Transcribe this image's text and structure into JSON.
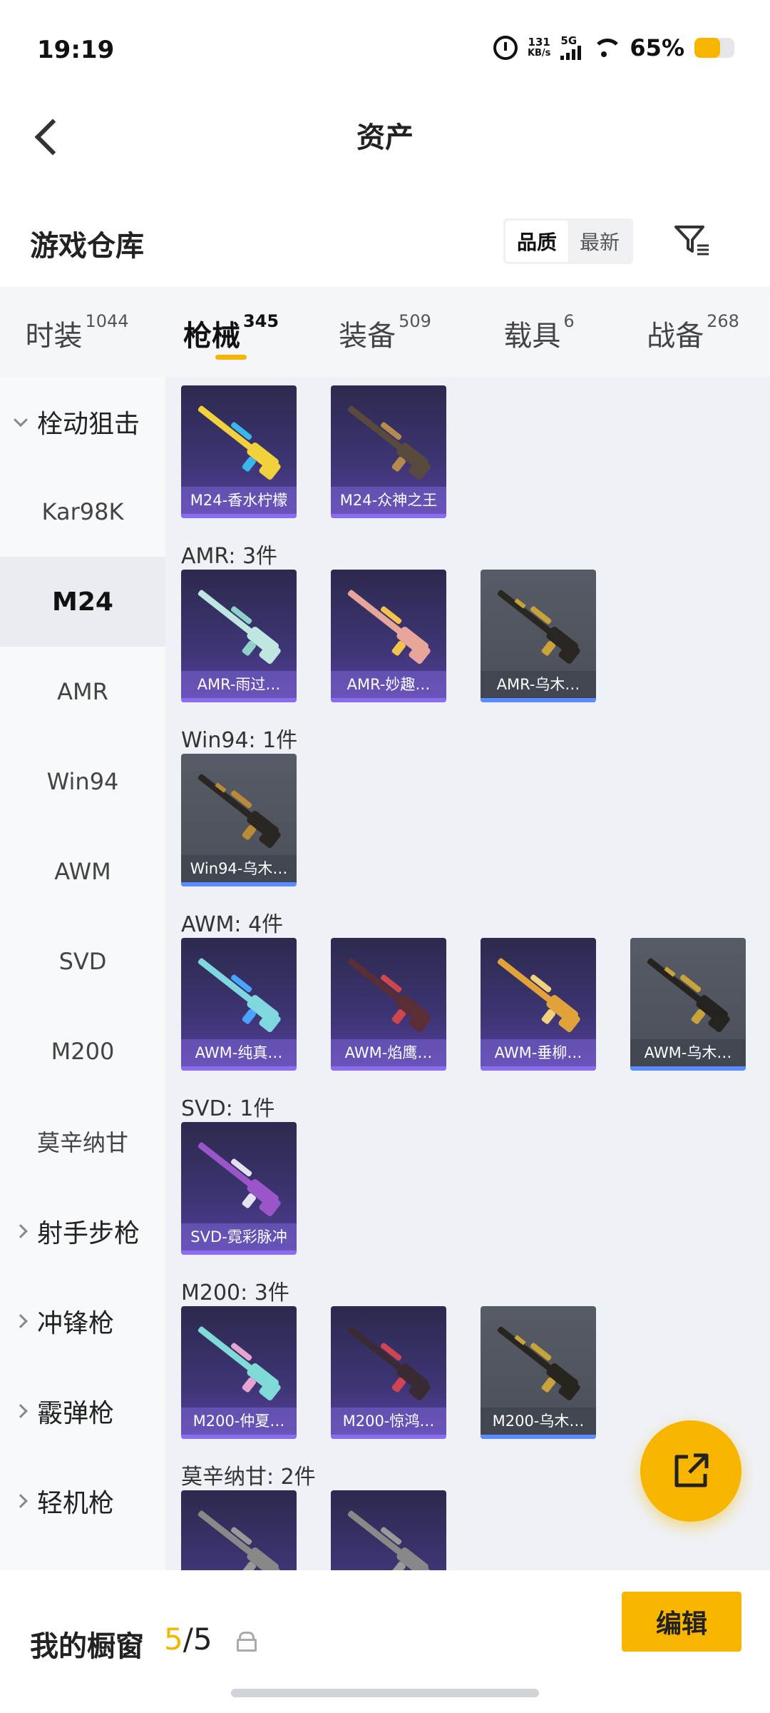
{
  "status": {
    "time": "19:19",
    "speed_value": "131",
    "speed_unit": "KB/s",
    "network": "5G",
    "battery_pct": "65%",
    "battery_level": 0.65
  },
  "nav": {
    "title": "资产"
  },
  "warehouse": {
    "title": "游戏仓库",
    "sort_options": [
      "品质",
      "最新"
    ],
    "sort_active": "品质"
  },
  "tabs": [
    {
      "label": "时装",
      "count": "1044",
      "active": false
    },
    {
      "label": "枪械",
      "count": "345",
      "active": true
    },
    {
      "label": "装备",
      "count": "509",
      "active": false
    },
    {
      "label": "载具",
      "count": "6",
      "active": false
    },
    {
      "label": "战备",
      "count": "268",
      "active": false
    }
  ],
  "sidebar": {
    "items": [
      {
        "label": "栓动狙击",
        "type": "group",
        "state": "open"
      },
      {
        "label": "Kar98K",
        "type": "item"
      },
      {
        "label": "M24",
        "type": "item",
        "active": true
      },
      {
        "label": "AMR",
        "type": "item"
      },
      {
        "label": "Win94",
        "type": "item"
      },
      {
        "label": "AWM",
        "type": "item"
      },
      {
        "label": "SVD",
        "type": "item"
      },
      {
        "label": "M200",
        "type": "item"
      },
      {
        "label": "莫辛纳甘",
        "type": "item"
      },
      {
        "label": "射手步枪",
        "type": "group",
        "state": "closed"
      },
      {
        "label": "冲锋枪",
        "type": "group",
        "state": "closed"
      },
      {
        "label": "霰弹枪",
        "type": "group",
        "state": "closed"
      },
      {
        "label": "轻机枪",
        "type": "group",
        "state": "closed"
      }
    ]
  },
  "sections": [
    {
      "label": "",
      "items": [
        {
          "name": "M24-香水柠檬",
          "rarity": "purple",
          "gun_color": "#f2d23c",
          "accent": "#3ab6e8"
        },
        {
          "name": "M24-众神之王",
          "rarity": "purple",
          "gun_color": "#5a4a3e",
          "accent": "#b58b4c"
        }
      ]
    },
    {
      "label": "AMR: 3件",
      "items": [
        {
          "name": "AMR-雨过…",
          "rarity": "purple",
          "gun_color": "#bfe6e0",
          "accent": "#8fd0c8"
        },
        {
          "name": "AMR-妙趣…",
          "rarity": "purple",
          "gun_color": "#e8a59a",
          "accent": "#f2c24a"
        },
        {
          "name": "AMR-乌木…",
          "rarity": "gray",
          "gun_color": "#2a2622",
          "accent": "#c9a23a"
        }
      ]
    },
    {
      "label": "Win94: 1件",
      "items": [
        {
          "name": "Win94-乌木…",
          "rarity": "gray",
          "gun_color": "#2a2622",
          "accent": "#b98a3a"
        }
      ]
    },
    {
      "label": "AWM: 4件",
      "items": [
        {
          "name": "AWM-纯真…",
          "rarity": "purple",
          "gun_color": "#7fd8e0",
          "accent": "#4aa3ff"
        },
        {
          "name": "AWM-焰鹰…",
          "rarity": "purple",
          "gun_color": "#5a2e34",
          "accent": "#d0464a"
        },
        {
          "name": "AWM-垂柳…",
          "rarity": "purple",
          "gun_color": "#e2a23a",
          "accent": "#f3d07a"
        },
        {
          "name": "AWM-乌木…",
          "rarity": "gray",
          "gun_color": "#252320",
          "accent": "#c9a23a"
        }
      ]
    },
    {
      "label": "SVD: 1件",
      "items": [
        {
          "name": "SVD-霓彩脉冲",
          "rarity": "purple",
          "gun_color": "#9a56c8",
          "accent": "#e3e3f0"
        }
      ]
    },
    {
      "label": "M200: 3件",
      "items": [
        {
          "name": "M200-仲夏…",
          "rarity": "purple",
          "gun_color": "#7fdad8",
          "accent": "#e7a4d0"
        },
        {
          "name": "M200-惊鸿…",
          "rarity": "purple",
          "gun_color": "#3a2a34",
          "accent": "#d04454"
        },
        {
          "name": "M200-乌木…",
          "rarity": "gray",
          "gun_color": "#282520",
          "accent": "#c9a23a"
        }
      ]
    },
    {
      "label": "莫辛纳甘: 2件",
      "items": [
        {
          "name": "",
          "rarity": "purple",
          "gun_color": "#888",
          "accent": "#999"
        },
        {
          "name": "",
          "rarity": "purple",
          "gun_color": "#888",
          "accent": "#999"
        }
      ]
    }
  ],
  "bottom": {
    "label": "我的橱窗",
    "current": "5",
    "total": "/5",
    "edit_label": "编辑"
  }
}
